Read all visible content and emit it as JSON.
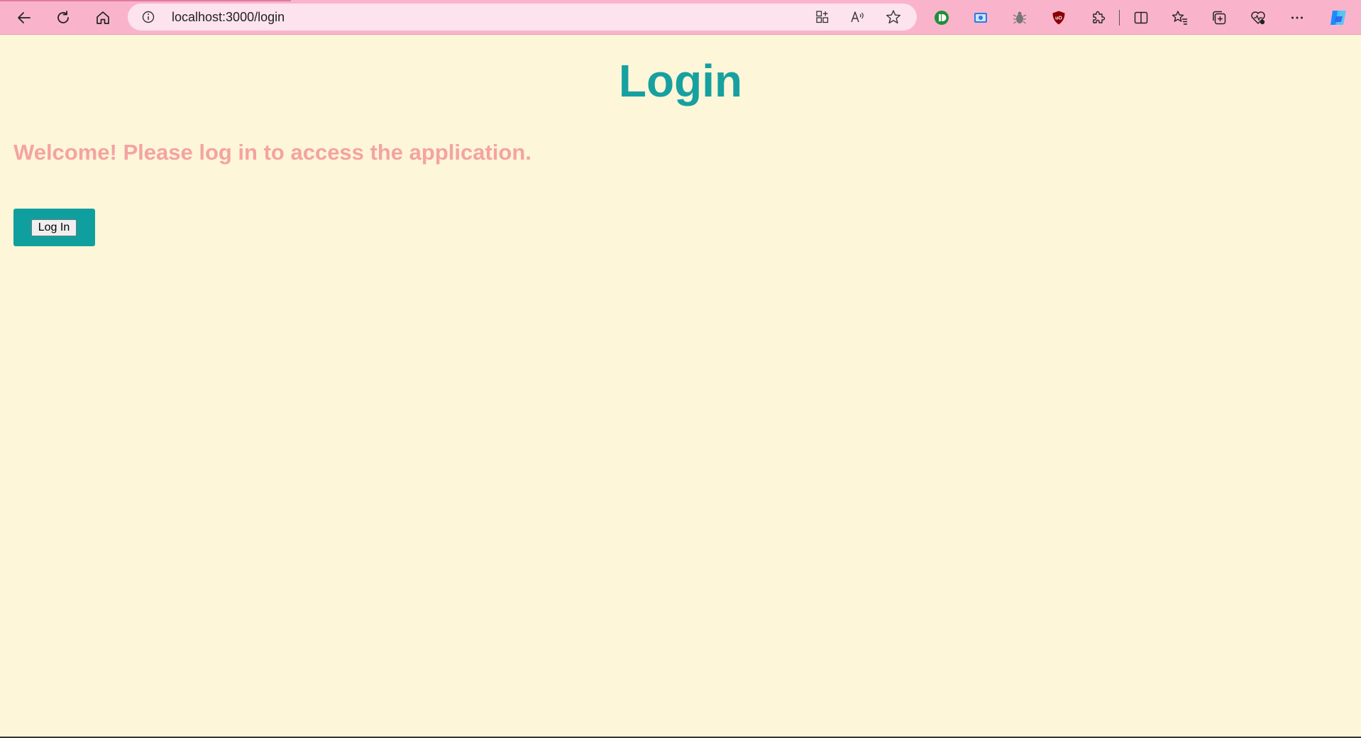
{
  "browser": {
    "url": "localhost:3000/login",
    "colors": {
      "toolbar": "#f9b4cc",
      "address_bar": "#fde3ee"
    },
    "nav_icons": [
      "back-arrow-icon",
      "refresh-icon",
      "home-icon"
    ],
    "address_icons": [
      "site-info-icon",
      "app-available-icon",
      "read-aloud-icon",
      "favorite-star-icon"
    ],
    "extension_icons": [
      "green-extension-icon",
      "screen-capture-icon",
      "bug-icon",
      "ublock-shield-icon",
      "extensions-puzzle-icon"
    ],
    "right_icons": [
      "split-screen-icon",
      "favorites-list-icon",
      "collections-icon",
      "browser-essentials-icon",
      "more-menu-icon",
      "copilot-icon"
    ]
  },
  "page": {
    "title": "Login",
    "welcome": "Welcome! Please log in to access the application.",
    "login_button_label": "Log In",
    "colors": {
      "background": "#fef6d8",
      "title": "#17a0a0",
      "welcome": "#f4a3a3",
      "button_panel": "#109f9f"
    }
  }
}
